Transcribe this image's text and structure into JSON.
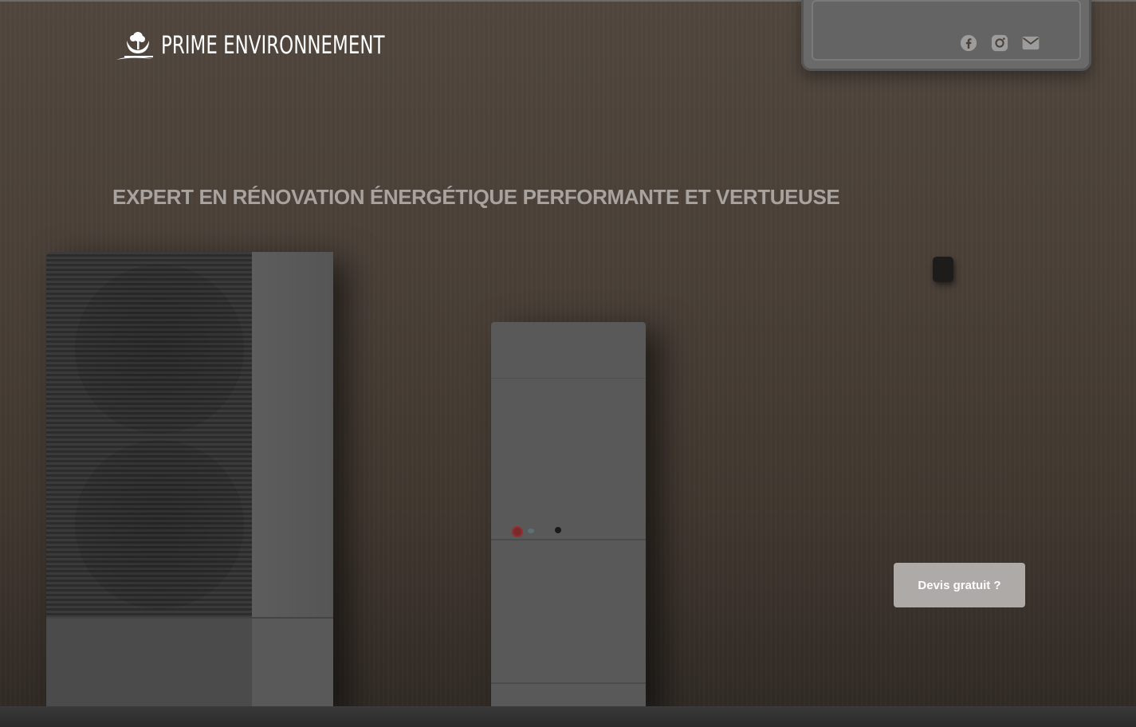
{
  "header": {
    "logo_text": "PRIME ENVIRONNEMENT",
    "social_links": [
      {
        "icon": "facebook-icon"
      },
      {
        "icon": "instagram-icon"
      },
      {
        "icon": "mail-icon"
      }
    ]
  },
  "hero": {
    "headline": "EXPERT EN RÉNOVATION ÉNERGÉTIQUE PERFORMANTE ET VERTUEUSE",
    "cta_label": "Devis gratuit ?"
  },
  "colors": {
    "headline": "#a8a39f",
    "cta_background": "#aeaaa7",
    "social_icon": "#9c9c9c",
    "logo": "#ffffff"
  }
}
